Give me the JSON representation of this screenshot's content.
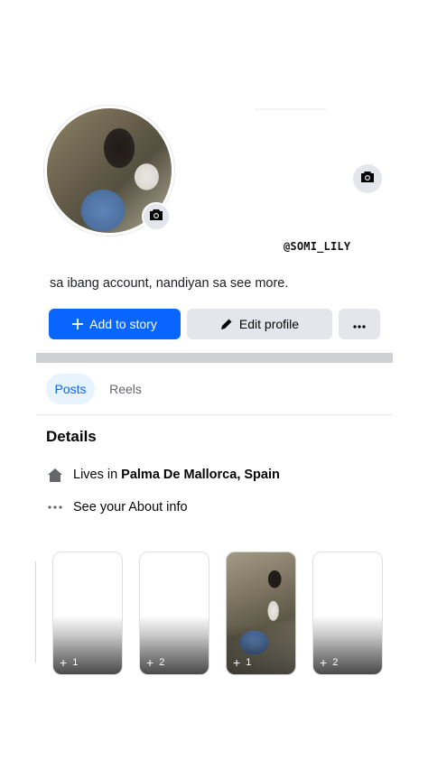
{
  "profile": {
    "username": "@SOMI_LILY",
    "bio": "sa ibang account, nandiyan sa see more."
  },
  "actions": {
    "add_story_label": "Add to story",
    "edit_profile_label": "Edit profile"
  },
  "tabs": [
    {
      "label": "Posts",
      "active": true
    },
    {
      "label": "Reels",
      "active": false
    }
  ],
  "details": {
    "title": "Details",
    "lives_prefix": "Lives in",
    "lives_place": "Palma De Mallorca, Spain",
    "about_label": "See your About info"
  },
  "story_cards": [
    {
      "count": "1",
      "has_photo": false
    },
    {
      "count": "2",
      "has_photo": false
    },
    {
      "count": "1",
      "has_photo": true
    },
    {
      "count": "2",
      "has_photo": false
    }
  ],
  "colors": {
    "accent": "#0866ff",
    "button_gray": "#e4e6eb",
    "tab_active_bg": "#e7f3ff"
  },
  "icons": {
    "camera": "camera-icon",
    "plus": "plus-icon",
    "pencil": "pencil-icon",
    "more": "more-horizontal-icon",
    "home": "home-icon"
  }
}
